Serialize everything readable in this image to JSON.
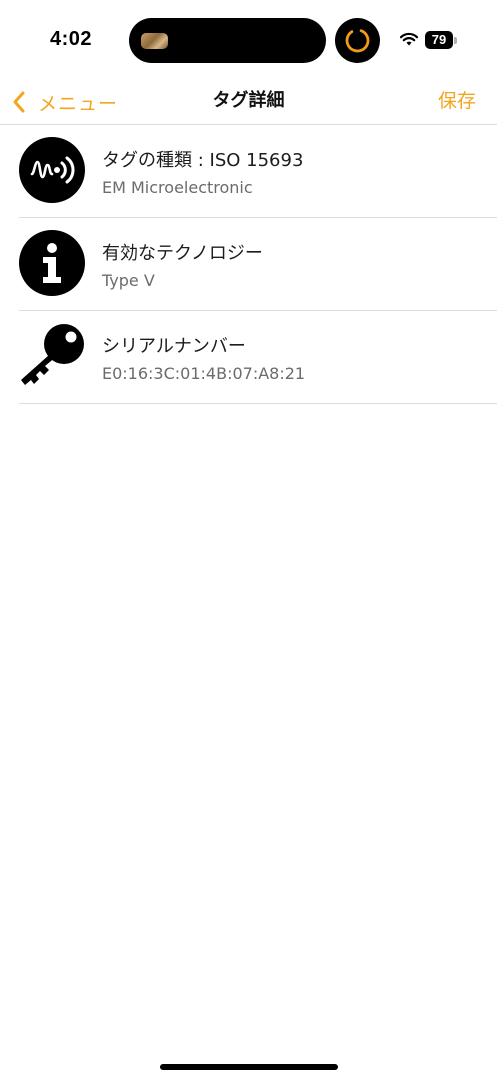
{
  "status_bar": {
    "time": "4:02",
    "battery": "79"
  },
  "nav": {
    "back_label": "メニュー",
    "title": "タグ詳細",
    "save_label": "保存"
  },
  "rows": [
    {
      "icon": "nfc-signal-icon",
      "title": "タグの種類 : ISO 15693",
      "subtitle": "EM Microelectronic"
    },
    {
      "icon": "info-icon",
      "title": "有効なテクノロジー",
      "subtitle": "Type V"
    },
    {
      "icon": "key-icon",
      "title": "シリアルナンバー",
      "subtitle": "E0:16:3C:01:4B:07:A8:21"
    }
  ],
  "colors": {
    "accent": "#f2a51d",
    "separator": "#dcdcdc",
    "icon": "#000000"
  }
}
